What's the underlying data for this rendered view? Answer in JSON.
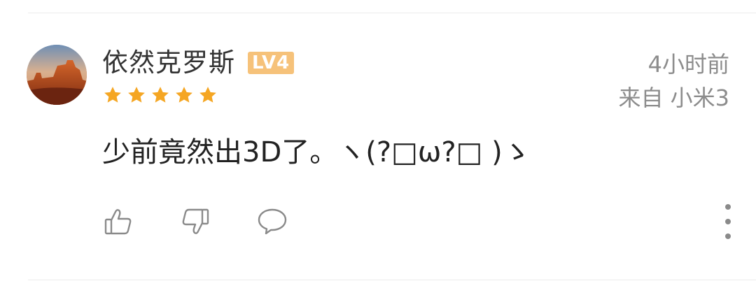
{
  "comment": {
    "username": "依然克罗斯",
    "level": "LV4",
    "rating": 5,
    "time": "4小时前",
    "device": "来自 小米3",
    "text": "少前竟然出3D了。ヽ(?□ω?□ )ゝ"
  },
  "actions": {
    "like_icon": "thumbs-up-icon",
    "dislike_icon": "thumbs-down-icon",
    "reply_icon": "speech-bubble-icon",
    "more_icon": "vertical-ellipsis-icon"
  },
  "colors": {
    "star": "#f5a623",
    "badge": "#f6c27a",
    "username": "#333333",
    "meta": "#8c8c8c",
    "icon": "#8a8a8a"
  }
}
